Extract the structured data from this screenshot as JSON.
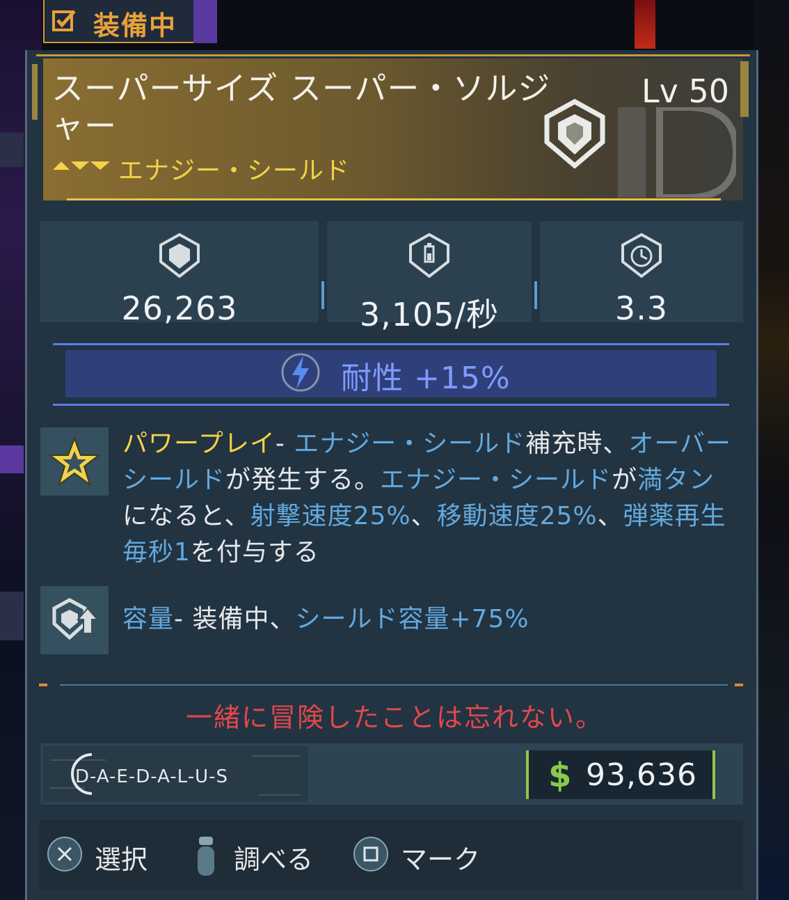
{
  "tab": {
    "label": "装備中",
    "icon": "checkmark-icon"
  },
  "item": {
    "name": "スーパーサイズ スーパー・ソルジャー",
    "level": "Lv 50",
    "type": "エナジー・シールド",
    "icon": "shield-icon"
  },
  "stats": [
    {
      "icon": "shield-capacity-icon",
      "value": "26,263"
    },
    {
      "icon": "shield-recharge-rate-icon",
      "value": "3,105/秒"
    },
    {
      "icon": "shield-recharge-delay-icon",
      "value": "3.3"
    }
  ],
  "bonus": {
    "icon": "lightning-icon",
    "text": "耐性 +15%"
  },
  "perks": [
    {
      "icon": "star-perk-icon",
      "segments": [
        {
          "t": "パワープレイ",
          "c": "y"
        },
        {
          "t": "- ",
          "c": "w"
        },
        {
          "t": "エナジー・シールド",
          "c": "b"
        },
        {
          "t": "補充時、",
          "c": "w"
        },
        {
          "t": "オーバーシールド",
          "c": "b"
        },
        {
          "t": "が発生する。",
          "c": "w"
        },
        {
          "t": "エナジー・シールド",
          "c": "b"
        },
        {
          "t": "が",
          "c": "w"
        },
        {
          "t": "満タン",
          "c": "b"
        },
        {
          "t": "になると、",
          "c": "w"
        },
        {
          "t": "射撃速度25%",
          "c": "b"
        },
        {
          "t": "、",
          "c": "w"
        },
        {
          "t": "移動速度25%",
          "c": "b"
        },
        {
          "t": "、",
          "c": "w"
        },
        {
          "t": "弾薬再生毎秒1",
          "c": "b"
        },
        {
          "t": "を付与する",
          "c": "w"
        }
      ]
    },
    {
      "icon": "capacity-up-perk-icon",
      "segments": [
        {
          "t": "容量",
          "c": "b"
        },
        {
          "t": "- 装備中、",
          "c": "w"
        },
        {
          "t": "シールド容量+75%",
          "c": "b"
        }
      ]
    }
  ],
  "flavor_text": "一緒に冒険したことは忘れない。",
  "manufacturer": {
    "text": "D-A-E-D-A-L-U-S",
    "icon": "daedalus-logo"
  },
  "price": {
    "currency_icon": "dollar-icon",
    "currency": "$",
    "value": "93,636"
  },
  "controls": [
    {
      "icon": "cross-button-icon",
      "label": "選択"
    },
    {
      "icon": "touchpad-icon",
      "label": "調べる"
    },
    {
      "icon": "square-button-icon",
      "label": "マーク"
    }
  ],
  "colors": {
    "gold": "#e8a13a",
    "type_yellow": "#f3d24a",
    "highlight_blue": "#63a9dd",
    "bonus_blue": "#7e9cff",
    "flavor_red": "#e2484a",
    "price_green": "#8cc84a"
  }
}
